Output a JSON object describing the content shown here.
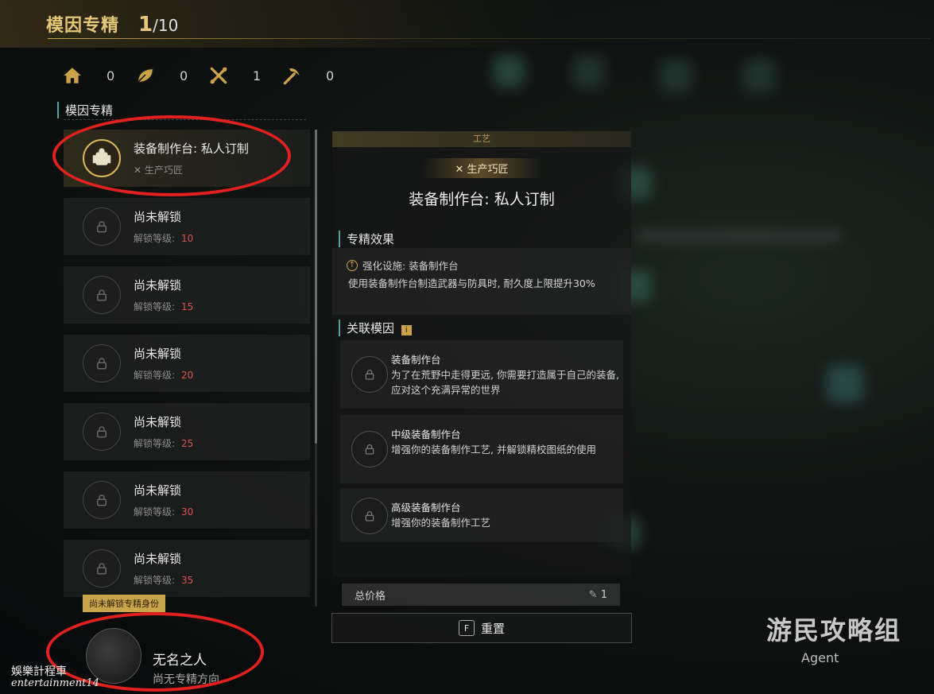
{
  "header": {
    "title": "模因专精",
    "count": "1",
    "total": "/10"
  },
  "stats": [
    {
      "icon": "home-icon",
      "value": "0"
    },
    {
      "icon": "leaf-icon",
      "value": "0"
    },
    {
      "icon": "crossed-tools-icon",
      "value": "1"
    },
    {
      "icon": "pickaxe-icon",
      "value": "0"
    }
  ],
  "section_label": "模因专精",
  "list": [
    {
      "name": "装备制作台: 私人订制",
      "sub": "生产巧匠",
      "active": true
    },
    {
      "name": "尚未解锁",
      "sub": "解锁等级:",
      "level": "10"
    },
    {
      "name": "尚未解锁",
      "sub": "解锁等级:",
      "level": "15"
    },
    {
      "name": "尚未解锁",
      "sub": "解锁等级:",
      "level": "20"
    },
    {
      "name": "尚未解锁",
      "sub": "解锁等级:",
      "level": "25"
    },
    {
      "name": "尚未解锁",
      "sub": "解锁等级:",
      "level": "30"
    },
    {
      "name": "尚未解锁",
      "sub": "解锁等级:",
      "level": "35"
    }
  ],
  "profile": {
    "tag": "尚未解锁专精身份",
    "name": "无名之人",
    "desc": "尚无专精方向"
  },
  "detail": {
    "band": "工艺",
    "badge": "生产巧匠",
    "title": "装备制作台: 私人订制",
    "effect_label": "专精效果",
    "effect_head": "强化设施: 装备制作台",
    "effect_body": "使用装备制作台制造武器与防具时, 耐久度上限提升30%",
    "related_label": "关联模因",
    "genes": [
      {
        "name": "装备制作台",
        "desc": "为了在荒野中走得更远, 你需要打造属于自己的装备, 应对这个充满异常的世界"
      },
      {
        "name": "中级装备制作台",
        "desc": "增强你的装备制作工艺, 并解锁精校图纸的使用"
      },
      {
        "name": "高级装备制作台",
        "desc": "增强你的装备制作工艺"
      }
    ],
    "price_label": "总价格",
    "price_value": "1"
  },
  "reset": {
    "key": "F",
    "label": "重置"
  },
  "watermarks": {
    "left1": "娛樂計程車",
    "left2": "entertainment14",
    "right": "游民攻略组",
    "agent": "Agent"
  },
  "colors": {
    "gold": "#e5c77a",
    "lock_red": "#d9534f",
    "annotation_red": "#e0211f"
  }
}
